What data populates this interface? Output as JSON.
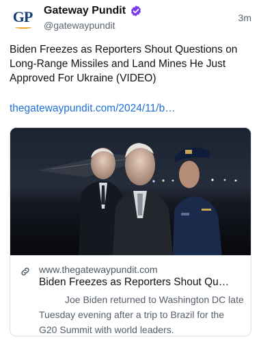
{
  "account": {
    "display_name": "Gateway Pundit",
    "handle": "@gatewaypundit",
    "avatar_text": "GP",
    "verified_icon": "verified-badge-icon",
    "verified_color": "#7c3aed",
    "brand_color": "#123b7a",
    "timestamp": "3m"
  },
  "post": {
    "text": "Biden Freezes as Reporters Shout Questions on Long-Range Missiles and Land Mines He Just Approved For Ukraine (VIDEO)",
    "link_text": "thegatewaypundit.com/2024/11/b…",
    "link_color": "#1d6fd6"
  },
  "card": {
    "link_icon": "link-icon",
    "domain": "www.thegatewaypundit.com",
    "title": "Biden Freezes as Reporters Shout Qu…",
    "description": "Joe Biden returned to Washington DC late Tuesday evening after a trip to Brazil for the G20 Summit with world leaders."
  }
}
